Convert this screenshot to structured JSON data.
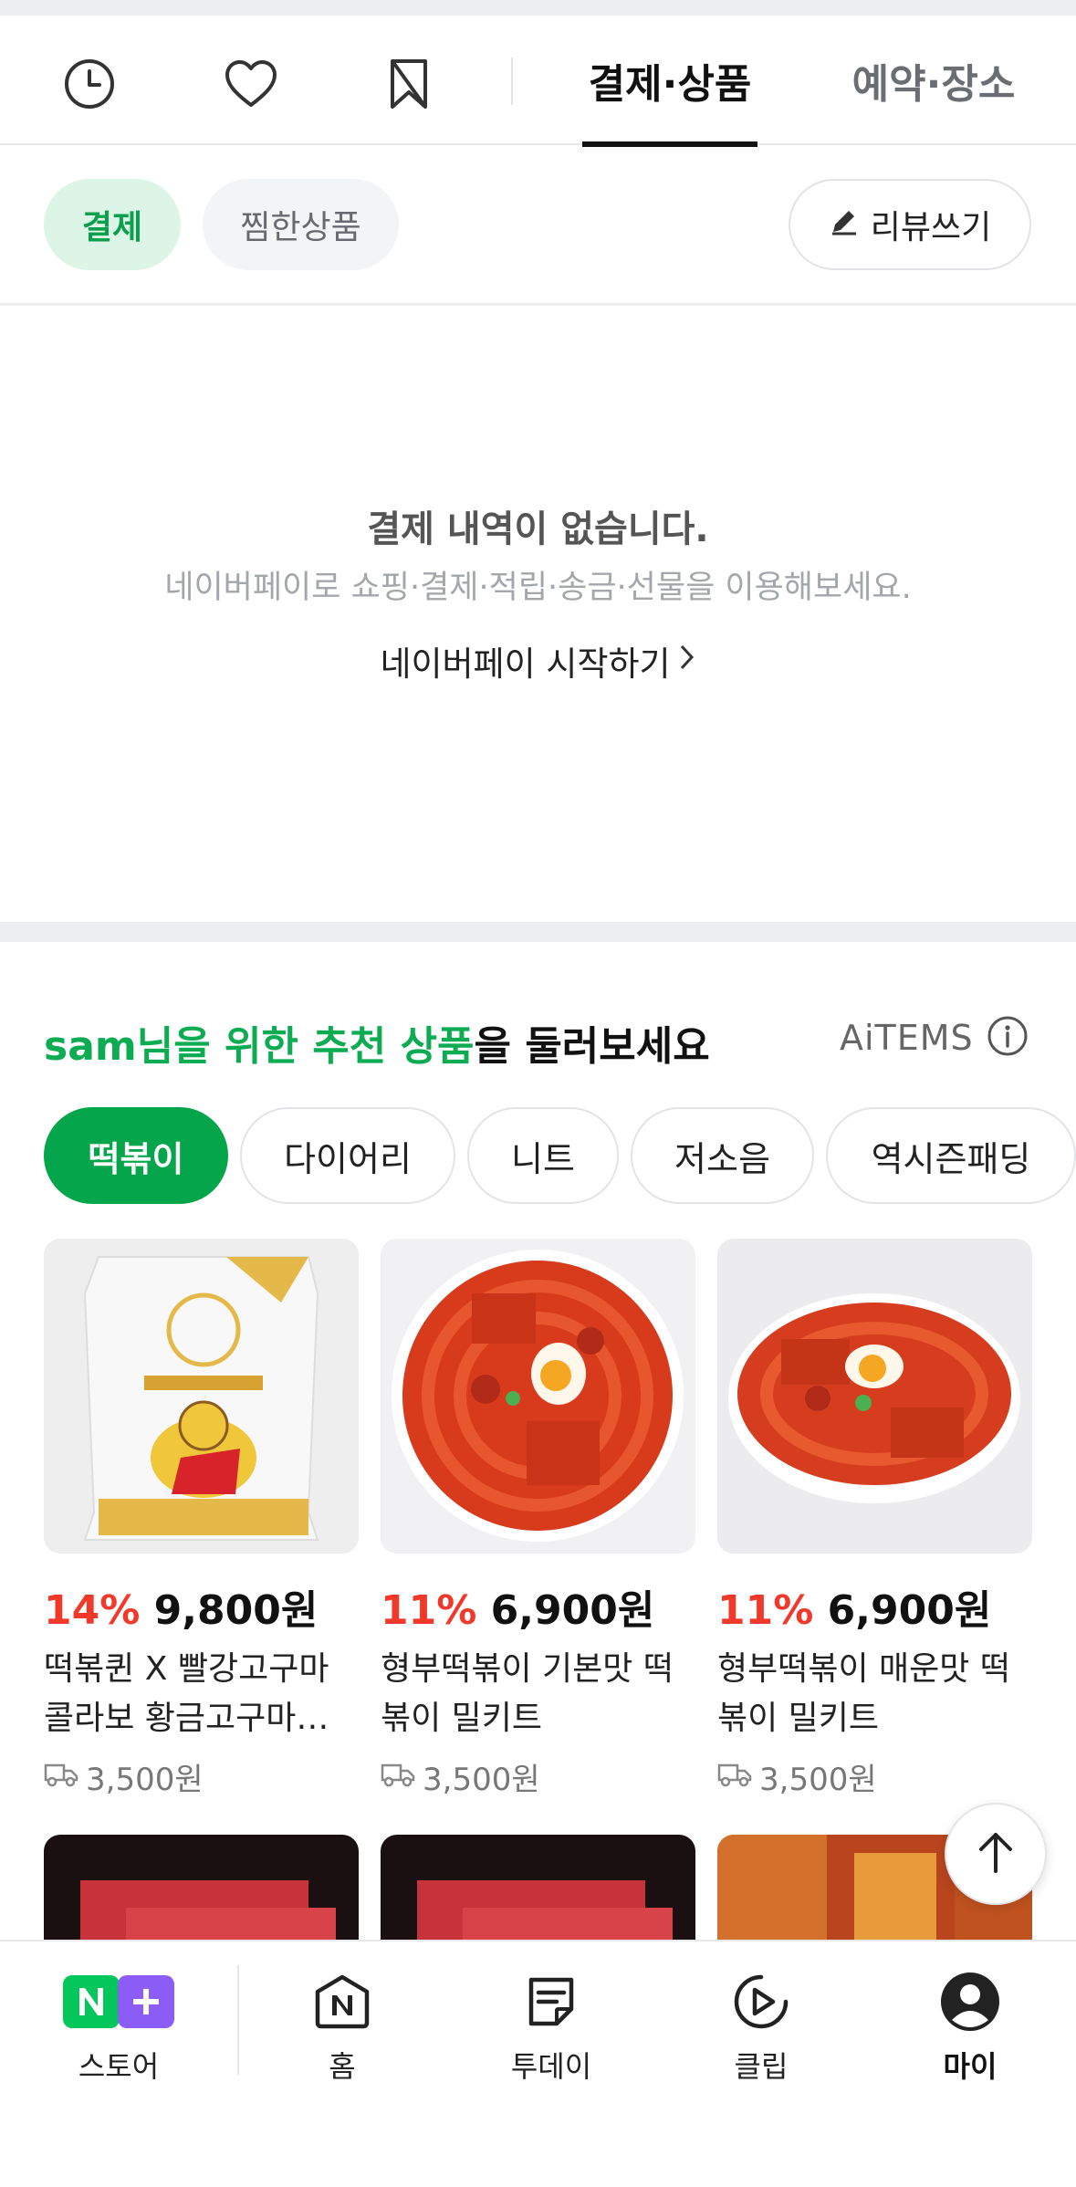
{
  "tabs": {
    "icons": [
      "clock-icon",
      "heart-icon",
      "bookmark-icon"
    ],
    "active": "결제·상품",
    "inactive": "예약·장소"
  },
  "filters": {
    "pay": "결제",
    "liked": "찜한상품",
    "review": "리뷰쓰기"
  },
  "empty_state": {
    "title": "결제 내역이 없습니다.",
    "subtitle": "네이버페이로 쇼핑·결제·적립·송금·선물을 이용해보세요.",
    "link": "네이버페이 시작하기"
  },
  "recommend": {
    "user": "sam",
    "highlight": "님을 위한 추천 상품",
    "rest": "을 둘러보세요",
    "brand": "AiTEMS",
    "categories": [
      "떡볶이",
      "다이어리",
      "니트",
      "저소음",
      "역시즌패딩"
    ]
  },
  "products": [
    {
      "discount": "14%",
      "price": "9,800원",
      "name": "떡볶퀸 X 빨강고구마 콜라보 황금고구마떡볶이 밀키트",
      "shipping": "3,500원"
    },
    {
      "discount": "11%",
      "price": "6,900원",
      "name": "형부떡볶이 기본맛 떡볶이 밀키트",
      "shipping": "3,500원"
    },
    {
      "discount": "11%",
      "price": "6,900원",
      "name": "형부떡볶이 매운맛 떡볶이 밀키트",
      "shipping": "3,500원"
    }
  ],
  "nav": {
    "store": "스토어",
    "home": "홈",
    "today": "투데이",
    "clip": "클립",
    "my": "마이"
  },
  "colors": {
    "naver_green": "#05a64b",
    "discount_red": "#f0392b",
    "store_purple": "#8b5cf6"
  }
}
